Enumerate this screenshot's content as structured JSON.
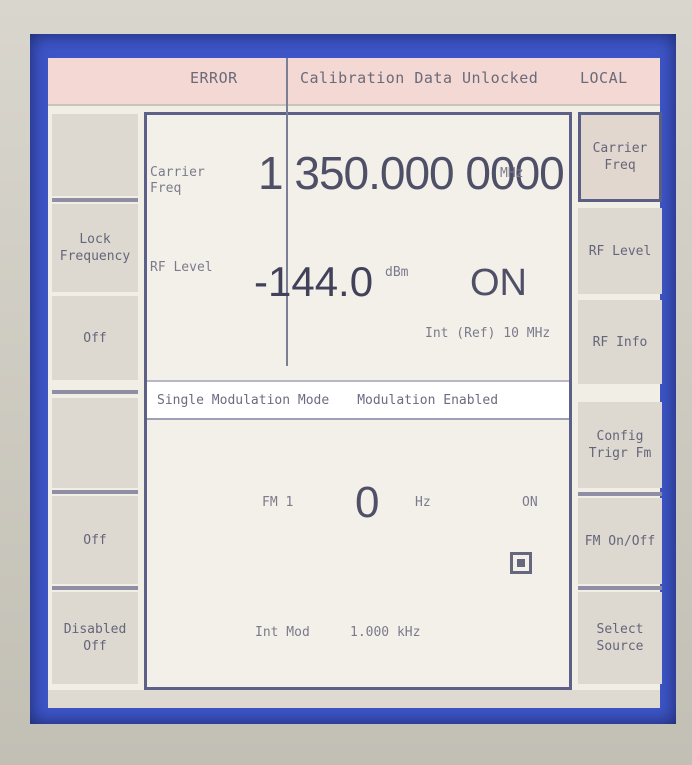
{
  "header": {
    "left_code": "ERROR",
    "message": "Calibration Data Unlocked",
    "right_code": "LOCAL"
  },
  "left_softkeys": [
    {
      "label": "",
      "name": "softkey-left-1"
    },
    {
      "label": "Lock Frequency",
      "name": "softkey-left-2"
    },
    {
      "label": "Off",
      "name": "softkey-left-3"
    },
    {
      "label": "",
      "name": "softkey-left-4"
    },
    {
      "label": "Off",
      "name": "softkey-left-5"
    },
    {
      "label": "Disabled Off",
      "name": "softkey-left-6"
    }
  ],
  "right_softkeys": [
    {
      "label": "Carrier Freq",
      "name": "softkey-carrier-freq"
    },
    {
      "label": "RF Level",
      "name": "softkey-rf-level"
    },
    {
      "label": "RF Info",
      "name": "softkey-rf-info"
    },
    {
      "label": "Config Trigr Fm",
      "name": "softkey-config"
    },
    {
      "label": "FM On/Off",
      "name": "softkey-fm-onoff"
    },
    {
      "label": "Select Source",
      "name": "softkey-select-source"
    }
  ],
  "carrier": {
    "label": "Carrier Freq",
    "value": "1 350.000 0000",
    "unit": "MHz"
  },
  "rf_level": {
    "label": "RF Level",
    "value": "-144.0",
    "unit": "dBm",
    "state": "ON",
    "note": "Int (Ref) 10 MHz"
  },
  "modulation": {
    "mode_text": "Single Modulation Mode",
    "status_text": "Modulation Enabled"
  },
  "fm": {
    "label": "FM 1",
    "value": "0",
    "unit": "Hz",
    "state_label": "ON",
    "source_left": "Int Mod",
    "source_right": "1.000 kHz"
  }
}
